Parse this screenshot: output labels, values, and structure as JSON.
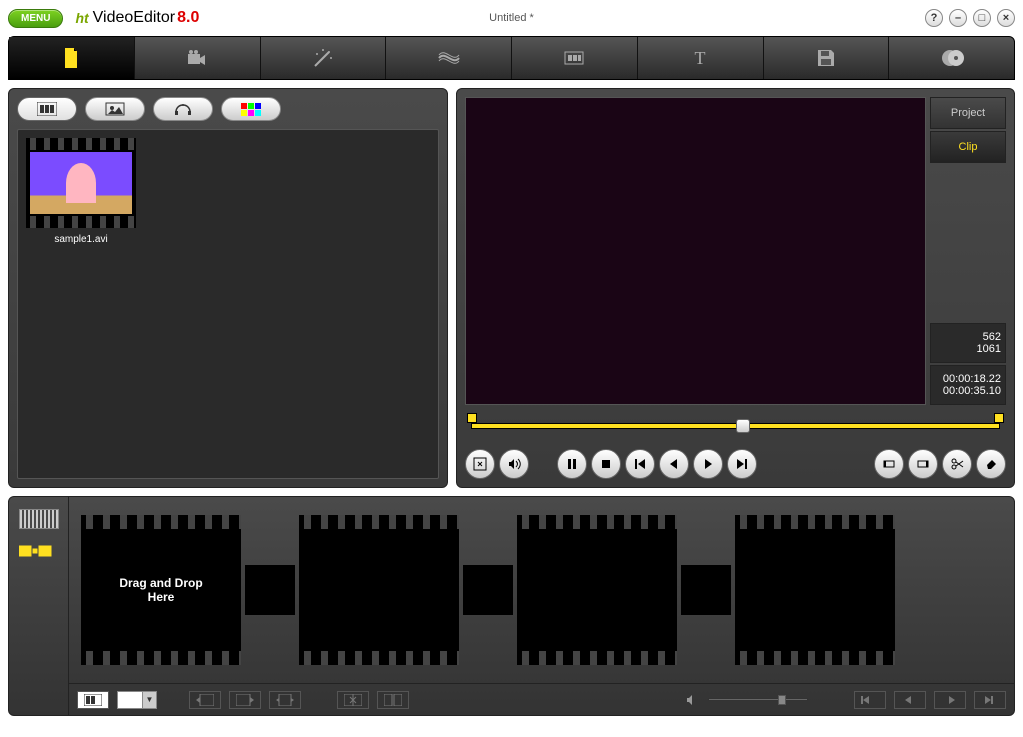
{
  "app": {
    "logo_prefix": "ht",
    "logo_title": "VideoEditor",
    "logo_version": "8.0",
    "document_title": "Untitled *",
    "menu_label": "MENU"
  },
  "media": {
    "items": [
      {
        "filename": "sample1.avi"
      }
    ]
  },
  "preview": {
    "tabs": {
      "project": "Project",
      "clip": "Clip"
    },
    "frame_current": "562",
    "frame_total": "1061",
    "time_current": "00:00:18.22",
    "time_total": "00:00:35.10"
  },
  "storyboard": {
    "drop_hint": "Drag and Drop\nHere"
  }
}
